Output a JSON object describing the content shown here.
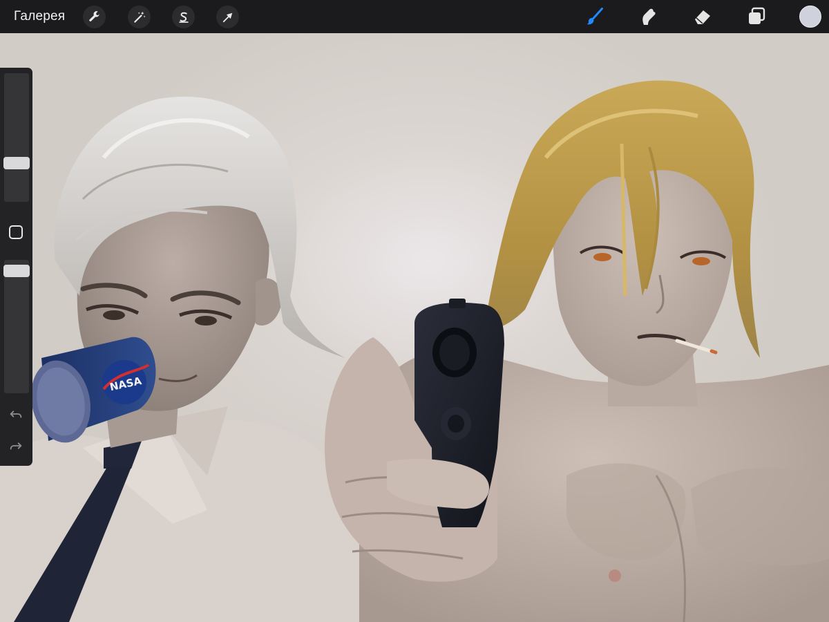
{
  "toolbar": {
    "gallery_label": "Галерея",
    "left_tools": [
      {
        "name": "actions",
        "icon": "wrench-icon"
      },
      {
        "name": "adjustments",
        "icon": "magic-wand-icon"
      },
      {
        "name": "selection",
        "icon": "selection-s-icon"
      },
      {
        "name": "transform",
        "icon": "arrow-cursor-icon"
      }
    ],
    "right_tools": [
      {
        "name": "brush",
        "icon": "brush-icon",
        "active": true
      },
      {
        "name": "smudge",
        "icon": "smudge-icon",
        "active": false
      },
      {
        "name": "eraser",
        "icon": "eraser-icon",
        "active": false
      },
      {
        "name": "layers",
        "icon": "layers-icon",
        "active": false
      }
    ],
    "active_color": "#cfd2dc",
    "active_tool_color": "#1f8bff"
  },
  "sidebar": {
    "brush_size_level": 0.72,
    "opacity_level": 0.95,
    "icons": [
      "square-modify-icon",
      "undo-icon",
      "redo-icon"
    ]
  },
  "canvas": {
    "background": "#d8d2cd",
    "can_label": "NASA"
  }
}
